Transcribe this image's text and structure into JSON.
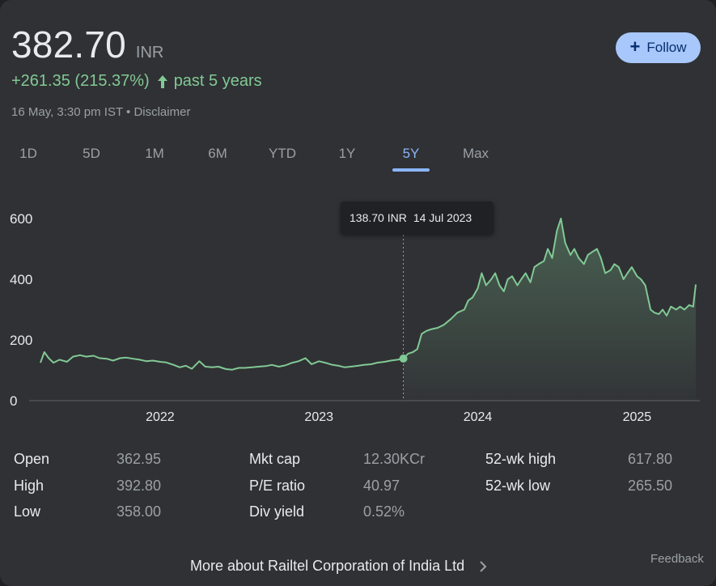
{
  "quote": {
    "price": "382.70",
    "currency": "INR",
    "change": "+261.35 (215.37%)",
    "period": "past 5 years",
    "timestamp": "16 May, 3:30 pm IST",
    "separator": " • ",
    "disclaimer": "Disclaimer",
    "change_color": "#81c995",
    "arrow_icon": "arrow-up-icon"
  },
  "follow_button": {
    "label": "Follow",
    "icon": "plus-icon"
  },
  "range_tabs": {
    "items": [
      "1D",
      "5D",
      "1M",
      "6M",
      "YTD",
      "1Y",
      "5Y",
      "Max"
    ],
    "active": "5Y"
  },
  "tooltip": {
    "value": "138.70 INR",
    "date": "14 Jul 2023"
  },
  "chart_data": {
    "type": "area",
    "x_unit": "date",
    "y_ticks": [
      0,
      200,
      400,
      600
    ],
    "x_ticks": [
      "2022",
      "2023",
      "2024",
      "2025"
    ],
    "x_tick_dates": [
      "2022-01-01",
      "2023-01-01",
      "2024-01-01",
      "2025-01-01"
    ],
    "ylim": [
      0,
      600
    ],
    "xlim": [
      "2021-04-01",
      "2025-05-16"
    ],
    "grid": false,
    "line_color": "#81c995",
    "highlight": {
      "date": "2023-07-14",
      "value": 138.7
    },
    "series": [
      {
        "x": [
          "2021-04-01",
          "2021-04-10",
          "2021-04-20",
          "2021-05-01",
          "2021-05-15",
          "2021-06-01",
          "2021-06-15",
          "2021-07-01",
          "2021-07-15",
          "2021-08-01",
          "2021-08-15",
          "2021-09-01",
          "2021-09-15",
          "2021-10-01",
          "2021-10-15",
          "2021-11-01",
          "2021-11-15",
          "2021-12-01",
          "2021-12-15",
          "2022-01-01",
          "2022-01-15",
          "2022-02-01",
          "2022-02-15",
          "2022-03-01",
          "2022-03-15",
          "2022-04-01",
          "2022-04-15",
          "2022-05-01",
          "2022-05-15",
          "2022-06-01",
          "2022-06-15",
          "2022-07-01",
          "2022-07-15",
          "2022-08-01",
          "2022-08-15",
          "2022-09-01",
          "2022-09-15",
          "2022-10-01",
          "2022-10-15",
          "2022-11-01",
          "2022-11-15",
          "2022-12-01",
          "2022-12-15",
          "2023-01-01",
          "2023-01-15",
          "2023-02-01",
          "2023-02-15",
          "2023-03-01",
          "2023-03-15",
          "2023-04-01",
          "2023-04-15",
          "2023-05-01",
          "2023-05-15",
          "2023-06-01",
          "2023-06-15",
          "2023-07-01",
          "2023-07-14",
          "2023-07-25",
          "2023-08-05",
          "2023-08-15",
          "2023-08-25",
          "2023-09-05",
          "2023-09-15",
          "2023-10-01",
          "2023-10-15",
          "2023-11-01",
          "2023-11-15",
          "2023-12-01",
          "2023-12-10",
          "2023-12-20",
          "2024-01-01",
          "2024-01-10",
          "2024-01-20",
          "2024-02-01",
          "2024-02-10",
          "2024-02-20",
          "2024-03-01",
          "2024-03-10",
          "2024-03-20",
          "2024-04-01",
          "2024-04-10",
          "2024-04-20",
          "2024-05-01",
          "2024-05-10",
          "2024-05-20",
          "2024-06-01",
          "2024-06-10",
          "2024-06-20",
          "2024-07-01",
          "2024-07-10",
          "2024-07-20",
          "2024-08-01",
          "2024-08-10",
          "2024-08-20",
          "2024-09-01",
          "2024-09-10",
          "2024-09-20",
          "2024-10-01",
          "2024-10-10",
          "2024-10-20",
          "2024-11-01",
          "2024-11-10",
          "2024-11-20",
          "2024-12-01",
          "2024-12-10",
          "2024-12-20",
          "2025-01-01",
          "2025-01-10",
          "2025-01-20",
          "2025-02-01",
          "2025-02-10",
          "2025-02-20",
          "2025-03-01",
          "2025-03-10",
          "2025-03-20",
          "2025-04-01",
          "2025-04-10",
          "2025-04-20",
          "2025-05-01",
          "2025-05-10",
          "2025-05-16"
        ],
        "values": [
          125,
          160,
          140,
          125,
          135,
          128,
          145,
          150,
          145,
          148,
          140,
          138,
          132,
          140,
          142,
          138,
          135,
          130,
          132,
          128,
          126,
          118,
          110,
          115,
          105,
          130,
          112,
          110,
          112,
          104,
          102,
          108,
          108,
          110,
          112,
          114,
          118,
          112,
          116,
          125,
          130,
          140,
          120,
          130,
          125,
          118,
          115,
          110,
          112,
          115,
          118,
          120,
          125,
          128,
          132,
          135,
          138.7,
          155,
          160,
          170,
          220,
          230,
          235,
          240,
          250,
          270,
          290,
          300,
          330,
          340,
          370,
          420,
          380,
          400,
          420,
          380,
          360,
          400,
          410,
          380,
          400,
          420,
          390,
          440,
          450,
          460,
          500,
          470,
          560,
          600,
          520,
          480,
          500,
          470,
          450,
          480,
          490,
          500,
          470,
          420,
          430,
          450,
          440,
          400,
          420,
          440,
          410,
          400,
          380,
          300,
          290,
          285,
          300,
          280,
          310,
          300,
          310,
          300,
          315,
          310,
          382.7
        ]
      }
    ]
  },
  "stats": {
    "col1": [
      {
        "label": "Open",
        "value": "362.95"
      },
      {
        "label": "High",
        "value": "392.80"
      },
      {
        "label": "Low",
        "value": "358.00"
      }
    ],
    "col2": [
      {
        "label": "Mkt cap",
        "value": "12.30KCr"
      },
      {
        "label": "P/E ratio",
        "value": "40.97"
      },
      {
        "label": "Div yield",
        "value": "0.52%"
      }
    ],
    "col3": [
      {
        "label": "52-wk high",
        "value": "617.80"
      },
      {
        "label": "52-wk low",
        "value": "265.50"
      }
    ]
  },
  "footer": {
    "more_link": "More about Railtel Corporation of India Ltd",
    "feedback": "Feedback"
  }
}
